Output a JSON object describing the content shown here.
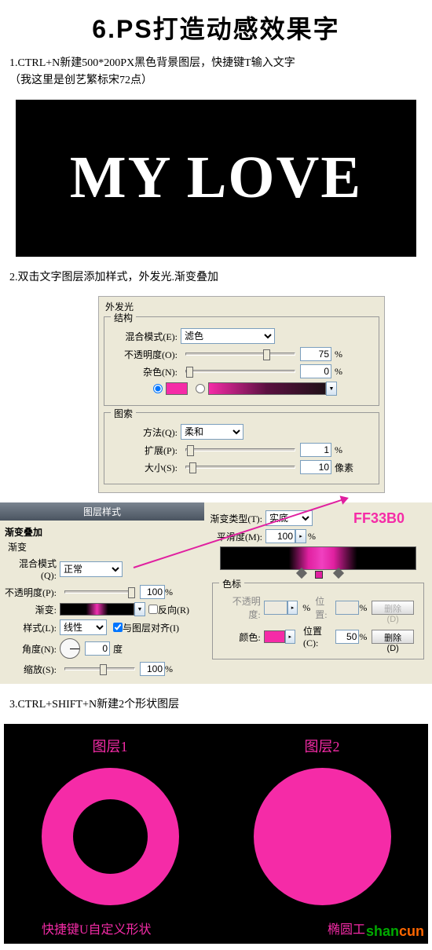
{
  "title": "6.PS打造动感效果字",
  "step1": {
    "text": "1.CTRL+N新建500*200PX黑色背景图层，快捷键T输入文字",
    "text_sub": "（我这里是创艺繁标宋72点）",
    "canvas_text": "MY LOVE"
  },
  "step2": {
    "text": "2.双击文字图层添加样式，外发光.渐变叠加",
    "outer_glow": {
      "legend": "外发光",
      "structure": {
        "legend": "结构",
        "blend_label": "混合模式(E):",
        "blend_value": "滤色",
        "opacity_label": "不透明度(O):",
        "opacity_value": "75",
        "noise_label": "杂色(N):",
        "noise_value": "0",
        "color_hex": "#f52ba7"
      },
      "elements": {
        "legend": "图索",
        "method_label": "方法(Q):",
        "method_value": "柔和",
        "spread_label": "扩展(P):",
        "spread_value": "1",
        "size_label": "大小(S):",
        "size_value": "10",
        "size_unit": "像素"
      }
    },
    "layer_style": {
      "title": "图层样式",
      "section": "渐变叠加",
      "sub": "渐变",
      "blend_label": "混合模式(Q):",
      "blend_value": "正常",
      "opacity_label": "不透明度(P):",
      "opacity_value": "100",
      "gradient_label": "渐变:",
      "reverse_label": "反向(R)",
      "style_label": "样式(L):",
      "style_value": "线性",
      "align_label": "与图层对齐(I)",
      "angle_label": "角度(N):",
      "angle_value": "0",
      "angle_unit": "度",
      "scale_label": "缩放(S):",
      "scale_value": "100"
    },
    "gradient_panel": {
      "type_label": "渐变类型(T):",
      "type_value": "实底",
      "smooth_label": "平滑度(M):",
      "smooth_value": "100",
      "hex_code": "FF33B0",
      "stops_legend": "色标",
      "stop_opacity_label": "不透明度:",
      "stop_pos_label": "位置:",
      "stop_pos_value": "50",
      "color_label": "颜色:",
      "pos_label": "位置(C):",
      "delete_label": "删除(D)"
    }
  },
  "step3": {
    "text": "3.CTRL+SHIFT+N新建2个形状图层",
    "layer1": "图层1",
    "layer2": "图层2",
    "label1": "快捷键U自定义形状",
    "label2": "椭圆工",
    "watermark": {
      "p1": "shan",
      "p2": "cun"
    }
  },
  "pct": "%"
}
